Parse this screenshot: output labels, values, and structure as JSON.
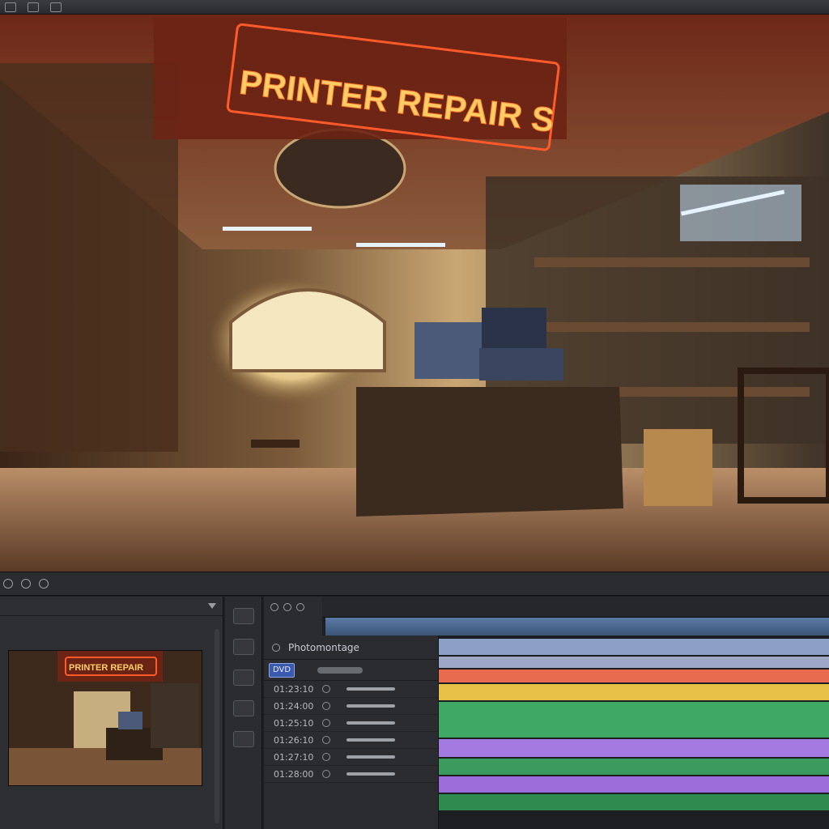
{
  "viewer": {
    "sign_text": "PRINTER REPAIR S",
    "sign_color": "#ff9a2e"
  },
  "preview": {
    "sign_text": "PRINTER REPAIR"
  },
  "track_panel": {
    "title": "Photomontage",
    "badge": "DVD"
  },
  "tracks": [
    {
      "name": "01:23:10"
    },
    {
      "name": "01:24:00"
    },
    {
      "name": "01:25:10"
    },
    {
      "name": "01:26:10"
    },
    {
      "name": "01:27:10"
    },
    {
      "name": "01:28:00"
    }
  ],
  "clips": [
    {
      "color": "#8ba0c4"
    },
    {
      "color": "#9fa7c9"
    },
    {
      "color": "#e86a4f"
    },
    {
      "color": "#e6c146"
    },
    {
      "color": "#3ea864"
    },
    {
      "color": "#a27ae0"
    },
    {
      "color": "#3b9a5e"
    },
    {
      "color": "#9c6cd9"
    },
    {
      "color": "#2f8a4f"
    }
  ],
  "icons": [
    "timeline-icon",
    "eye-icon",
    "settings-icon",
    "dropdown-icon"
  ]
}
